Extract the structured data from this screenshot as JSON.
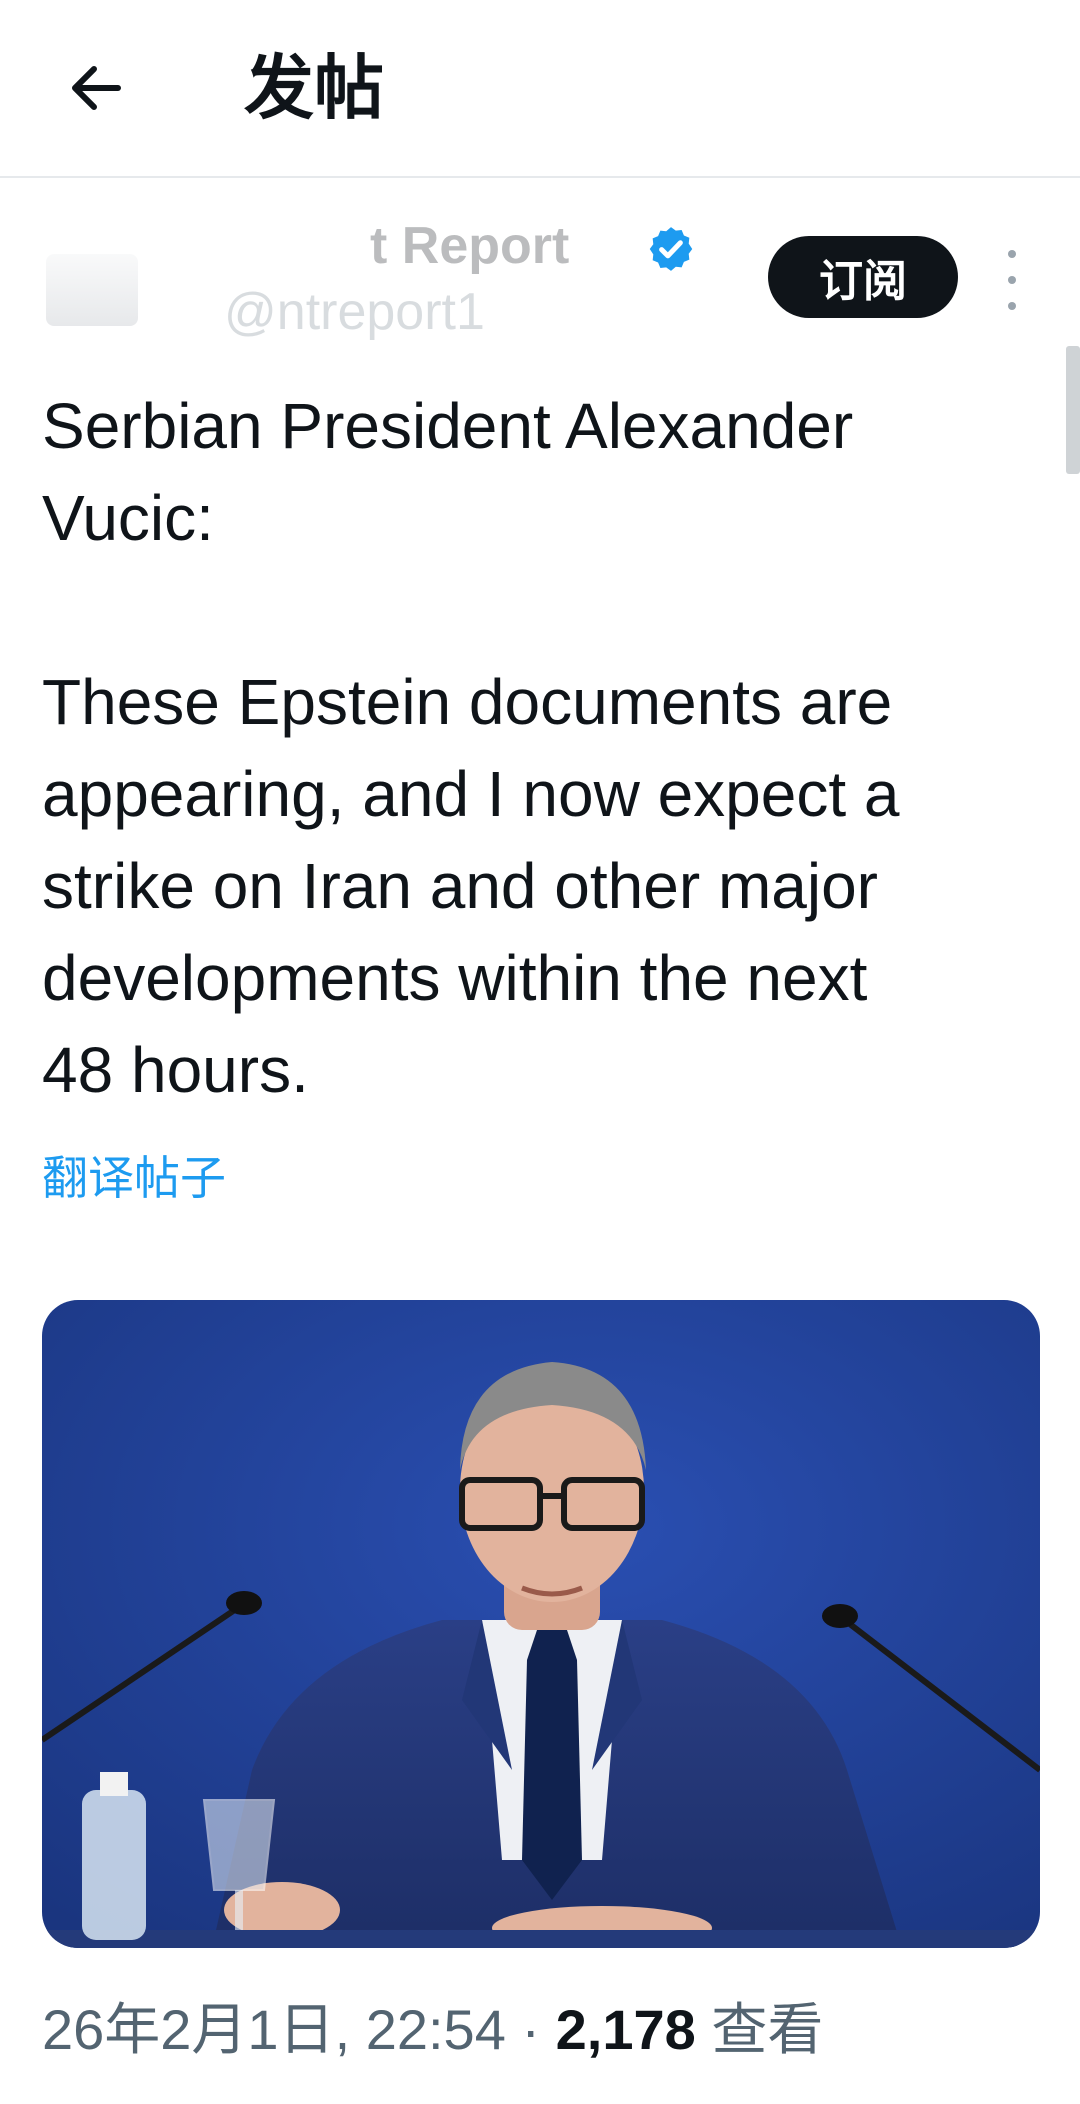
{
  "header": {
    "title": "发帖",
    "back_icon": "arrow-left-icon"
  },
  "author": {
    "display_name": "t Report",
    "handle": "@ntreport1",
    "verified_icon": "verified-badge-icon",
    "verified_color": "#1d9bf0",
    "subscribe_label": "订阅",
    "more_icon": "more-vertical-icon"
  },
  "post": {
    "text": "Serbian President Alexander\nVucic:\n\nThese Epstein documents are\nappearing, and I now expect a\nstrike on Iran and other major\ndevelopments within the next\n48 hours.",
    "translate_label": "翻译帖子"
  },
  "meta": {
    "date": "26年2月1日, 22:54",
    "separator": "·",
    "views_count": "2,178",
    "views_label": "查看"
  },
  "colors": {
    "accent": "#1d9bf0",
    "text": "#0f1419",
    "muted": "#536471",
    "media_background": "#1e3f9a"
  }
}
